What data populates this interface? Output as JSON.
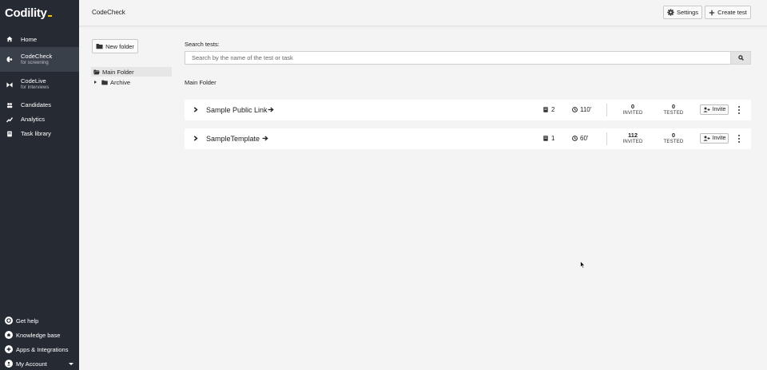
{
  "app": {
    "logo": "Codility"
  },
  "sidebar": {
    "items": [
      {
        "label": "Home",
        "sub": "",
        "icon": "home-icon"
      },
      {
        "label": "CodeCheck",
        "sub": "for screening",
        "icon": "codecheck-icon"
      },
      {
        "label": "CodeLive",
        "sub": "for interviews",
        "icon": "codelive-icon"
      },
      {
        "label": "Candidates",
        "sub": "",
        "icon": "candidates-icon"
      },
      {
        "label": "Analytics",
        "sub": "",
        "icon": "analytics-icon"
      },
      {
        "label": "Task library",
        "sub": "",
        "icon": "task-library-icon"
      }
    ],
    "bottom": [
      {
        "label": "Get help",
        "icon": "help-icon"
      },
      {
        "label": "Knowledge base",
        "icon": "knowledge-base-icon"
      },
      {
        "label": "Apps & Integrations",
        "icon": "integrations-icon"
      },
      {
        "label": "My Account",
        "icon": "account-icon"
      }
    ]
  },
  "header": {
    "title": "CodeCheck",
    "settings_label": "Settings",
    "create_label": "Create test"
  },
  "folders": {
    "new_folder_label": "New folder",
    "main": "Main Folder",
    "archive": "Archive"
  },
  "search": {
    "label": "Search tests:",
    "placeholder": "Search by the name of the test or task"
  },
  "breadcrumb": "Main Folder",
  "tests": [
    {
      "name": "Sample Public Link",
      "tasks": "2",
      "duration": "110'",
      "invited": "0",
      "invited_label": "INVITED",
      "tested": "0",
      "tested_label": "TESTED",
      "invite_label": "Invite"
    },
    {
      "name": "SampleTemplate",
      "tasks": "1",
      "duration": "60'",
      "invited": "112",
      "invited_label": "INVITED",
      "tested": "0",
      "tested_label": "TESTED",
      "invite_label": "Invite"
    }
  ],
  "colors": {
    "sidebar_bg": "#262b33",
    "active_bg": "#3a404a",
    "logo_accent": "#f7c600"
  }
}
